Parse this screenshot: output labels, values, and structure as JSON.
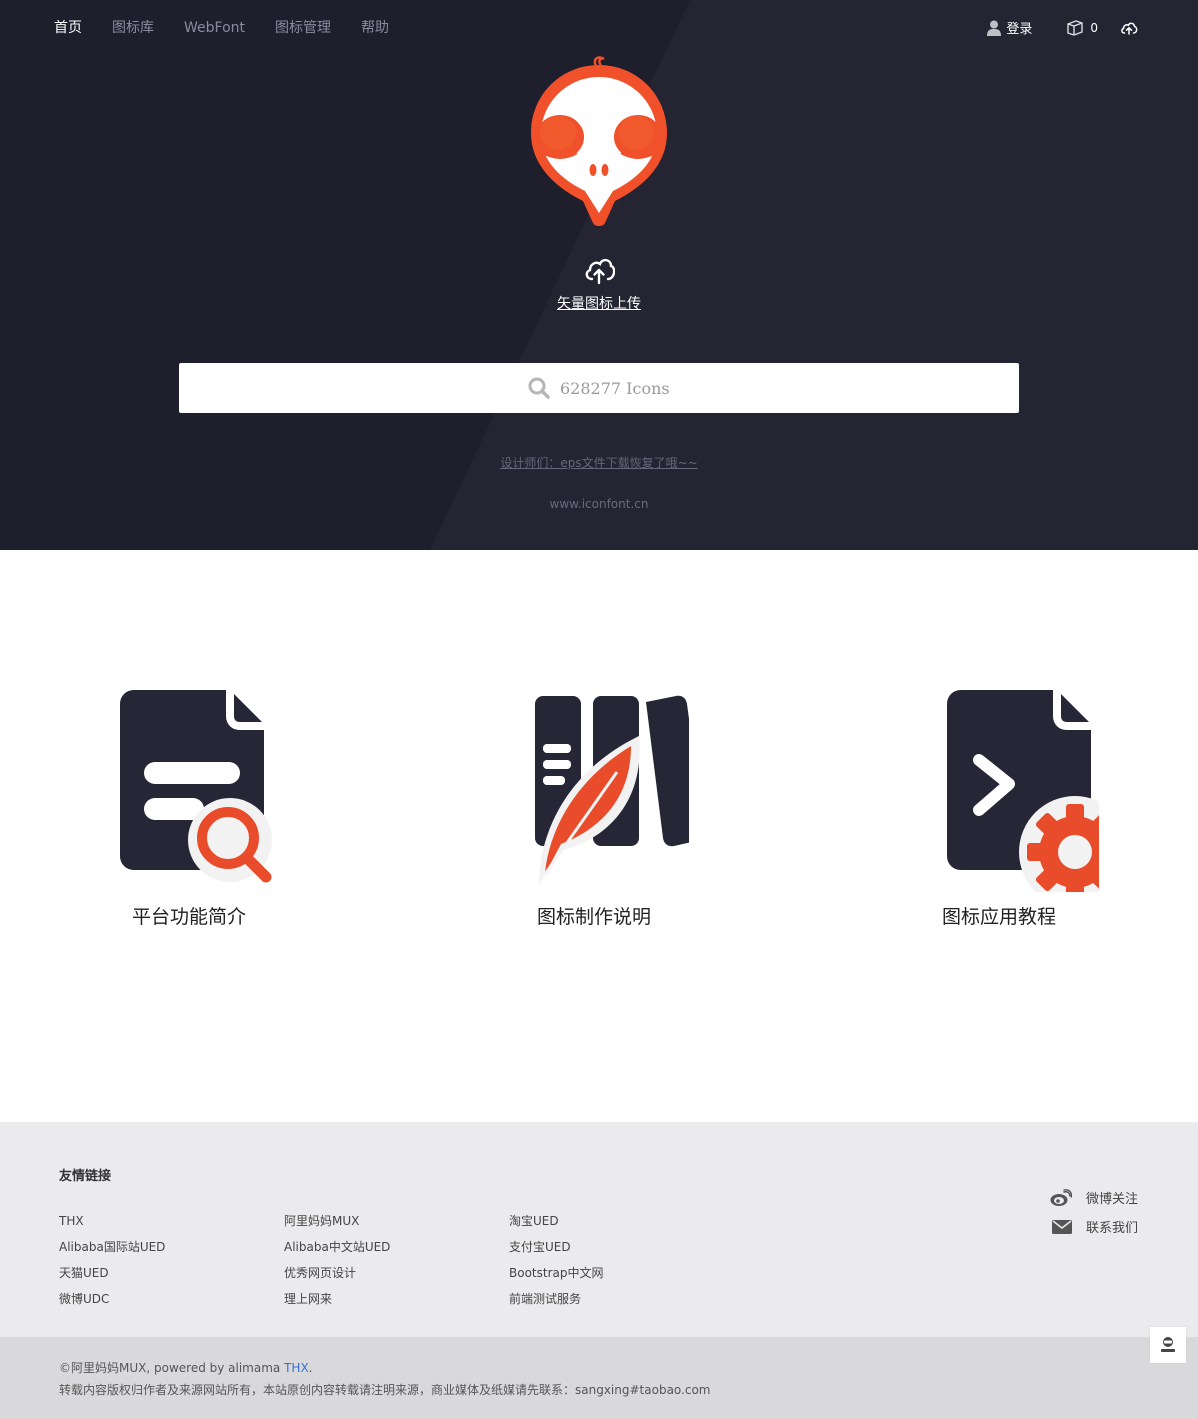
{
  "nav": {
    "items": [
      {
        "label": "首页",
        "active": true
      },
      {
        "label": "图标库"
      },
      {
        "label": "WebFont"
      },
      {
        "label": "图标管理"
      },
      {
        "label": "帮助"
      }
    ],
    "login_label": "登录",
    "cart_count": "0"
  },
  "hero": {
    "upload_label": "矢量图标上传",
    "search_placeholder": "628277 Icons",
    "notice": "设计师们：eps文件下载恢复了哦~~",
    "domain": "www.iconfont.cn"
  },
  "features": [
    {
      "title": "平台功能简介",
      "icon": "document-search-icon"
    },
    {
      "title": "图标制作说明",
      "icon": "books-feather-icon"
    },
    {
      "title": "图标应用教程",
      "icon": "code-document-gear-icon"
    }
  ],
  "footer": {
    "heading": "友情链接",
    "links": [
      "THX",
      "阿里妈妈MUX",
      "淘宝UED",
      "Alibaba国际站UED",
      "Alibaba中文站UED",
      "支付宝UED",
      "天猫UED",
      "优秀网页设计",
      "Bootstrap中文网",
      "微博UDC",
      "理上网来",
      "前端测试服务"
    ],
    "weibo_label": "微博关注",
    "contact_label": "联系我们",
    "copyright_prefix": "©阿里妈妈MUX, powered by alimama ",
    "copyright_thx": "THX",
    "copyright_suffix": ".",
    "copyright_line2": "转载内容版权归作者及来源网站所有，本站原创内容转载请注明来源，商业媒体及纸媒请先联系：sangxing#taobao.com"
  },
  "colors": {
    "hero_bg": "#242433",
    "accent": "#f0502a",
    "footer_bg": "#ebebed"
  }
}
